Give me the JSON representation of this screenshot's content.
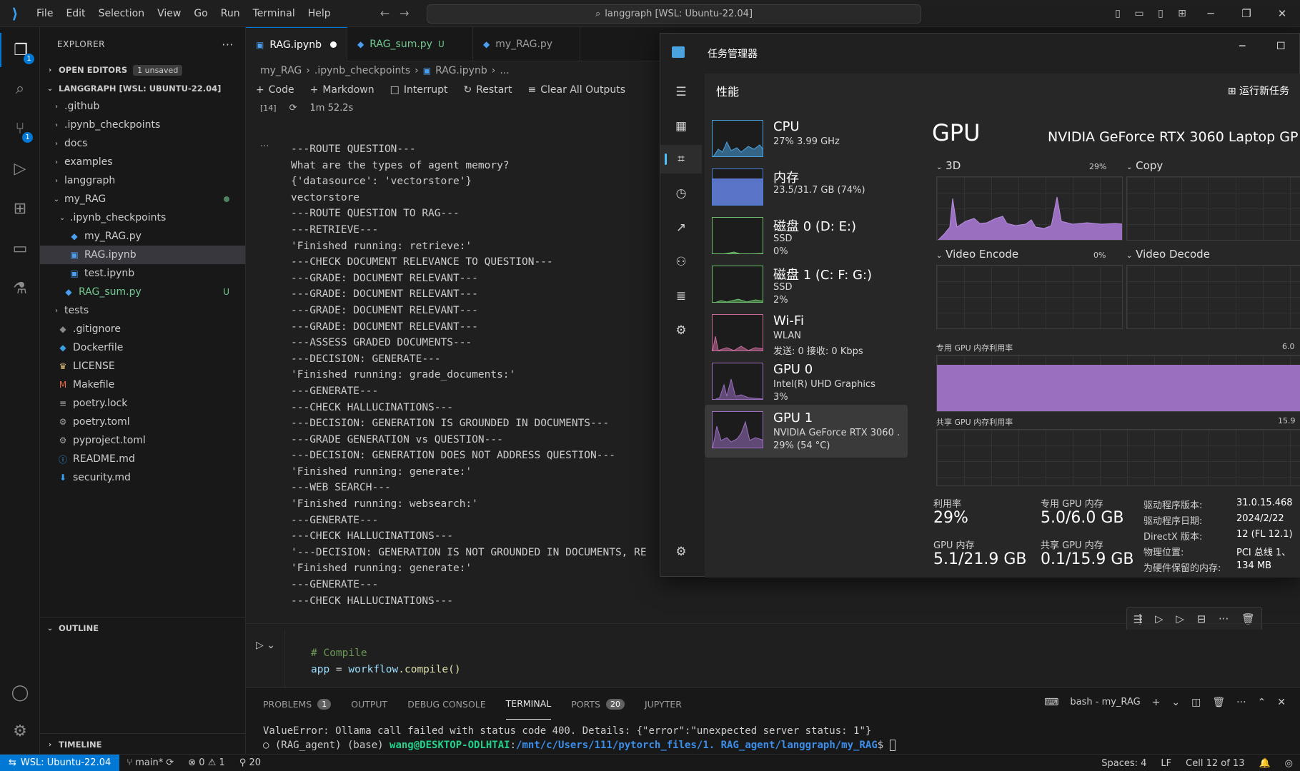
{
  "titlebar": {
    "menus": [
      "File",
      "Edit",
      "Selection",
      "View",
      "Go",
      "Run",
      "Terminal",
      "Help"
    ],
    "command_center": "langgraph [WSL: Ubuntu-22.04]"
  },
  "activity": {
    "explorer_badge": "1",
    "scm_badge": "1"
  },
  "sidebar": {
    "title": "EXPLORER",
    "open_editors": "OPEN EDITORS",
    "unsaved": "1 unsaved",
    "workspace": "LANGGRAPH [WSL: UBUNTU-22.04]",
    "tree": [
      {
        "label": ".github",
        "kind": "folder",
        "indent": 0
      },
      {
        "label": ".ipynb_checkpoints",
        "kind": "folder",
        "indent": 0
      },
      {
        "label": "docs",
        "kind": "folder",
        "indent": 0
      },
      {
        "label": "examples",
        "kind": "folder",
        "indent": 0
      },
      {
        "label": "langgraph",
        "kind": "folder",
        "indent": 0
      },
      {
        "label": "my_RAG",
        "kind": "folder-open",
        "indent": 0,
        "dot": true
      },
      {
        "label": ".ipynb_checkpoints",
        "kind": "folder-open",
        "indent": 1
      },
      {
        "label": "my_RAG.py",
        "kind": "py",
        "indent": 2
      },
      {
        "label": "RAG.ipynb",
        "kind": "nb",
        "indent": 2,
        "selected": true
      },
      {
        "label": "test.ipynb",
        "kind": "nb",
        "indent": 2
      },
      {
        "label": "RAG_sum.py",
        "kind": "py",
        "indent": 1,
        "status": "U"
      },
      {
        "label": "tests",
        "kind": "folder",
        "indent": 0
      },
      {
        "label": ".gitignore",
        "kind": "git",
        "indent": 0
      },
      {
        "label": "Dockerfile",
        "kind": "docker",
        "indent": 0
      },
      {
        "label": "LICENSE",
        "kind": "license",
        "indent": 0
      },
      {
        "label": "Makefile",
        "kind": "make",
        "indent": 0
      },
      {
        "label": "poetry.lock",
        "kind": "lock",
        "indent": 0
      },
      {
        "label": "poetry.toml",
        "kind": "gear",
        "indent": 0
      },
      {
        "label": "pyproject.toml",
        "kind": "gear",
        "indent": 0
      },
      {
        "label": "README.md",
        "kind": "info",
        "indent": 0
      },
      {
        "label": "security.md",
        "kind": "md",
        "indent": 0
      }
    ],
    "outline": "OUTLINE",
    "timeline": "TIMELINE"
  },
  "editor": {
    "tabs": [
      {
        "label": "RAG.ipynb",
        "active": true,
        "dirty": true
      },
      {
        "label": "RAG_sum.py",
        "status": "U"
      },
      {
        "label": "my_RAG.py"
      }
    ],
    "breadcrumb": [
      "my_RAG",
      ".ipynb_checkpoints",
      "RAG.ipynb",
      "..."
    ],
    "toolbar": {
      "code": "Code",
      "markdown": "Markdown",
      "interrupt": "Interrupt",
      "restart": "Restart",
      "clear": "Clear All Outputs"
    },
    "cell_index": "[14]",
    "cell_time": "1m 52.2s",
    "output_lines": [
      "---ROUTE QUESTION---",
      "What are the types of agent memory?",
      "{'datasource': 'vectorstore'}",
      "vectorstore",
      "---ROUTE QUESTION TO RAG---",
      "---RETRIEVE---",
      "'Finished running: retrieve:'",
      "---CHECK DOCUMENT RELEVANCE TO QUESTION---",
      "---GRADE: DOCUMENT RELEVANT---",
      "---GRADE: DOCUMENT RELEVANT---",
      "---GRADE: DOCUMENT RELEVANT---",
      "---GRADE: DOCUMENT RELEVANT---",
      "---ASSESS GRADED DOCUMENTS---",
      "---DECISION: GENERATE---",
      "'Finished running: grade_documents:'",
      "---GENERATE---",
      "---CHECK HALLUCINATIONS---",
      "---DECISION: GENERATION IS GROUNDED IN DOCUMENTS---",
      "---GRADE GENERATION vs QUESTION---",
      "---DECISION: GENERATION DOES NOT ADDRESS QUESTION---",
      "'Finished running: generate:'",
      "---WEB SEARCH---",
      "'Finished running: websearch:'",
      "---GENERATE---",
      "---CHECK HALLUCINATIONS---",
      "'---DECISION: GENERATION IS NOT GROUNDED IN DOCUMENTS, RE",
      "'Finished running: generate:'",
      "---GENERATE---",
      "---CHECK HALLUCINATIONS---"
    ],
    "code_comment": "# Compile",
    "code_var": "app",
    "code_eq": " = ",
    "code_obj": "workflow",
    "code_call": ".compile()"
  },
  "panel": {
    "tabs": [
      "PROBLEMS",
      "OUTPUT",
      "DEBUG CONSOLE",
      "TERMINAL",
      "PORTS",
      "JUPYTER"
    ],
    "problems_count": "1",
    "ports_count": "20",
    "terminal_name": "bash - my_RAG",
    "line1": "ValueError: Ollama call failed with status code 400. Details: {\"error\":\"unexpected server status: 1\"}",
    "line2_prefix": "○ (RAG_agent) (base) ",
    "line2_user": "wang@DESKTOP-ODLHTAI",
    "line2_colon": ":",
    "line2_path": "/mnt/c/Users/111/pytorch_files/1. RAG_agent/langgraph/my_RAG",
    "line2_prompt": "$ "
  },
  "statusbar": {
    "remote": "WSL: Ubuntu-22.04",
    "branch": "main*",
    "errors": "0",
    "warnings": "1",
    "ports": "20",
    "spaces": "Spaces: 4",
    "eol": "LF",
    "cell": "Cell 12 of 13"
  },
  "taskmgr": {
    "title": "任务管理器",
    "section": "性能",
    "new_task": "运行新任务",
    "resources": [
      {
        "name": "CPU",
        "l1": "27% 3.99 GHz",
        "l2": "",
        "l3": ""
      },
      {
        "name": "内存",
        "l1": "23.5/31.7 GB (74%)",
        "l2": "",
        "l3": ""
      },
      {
        "name": "磁盘 0 (D: E:)",
        "l1": "SSD",
        "l2": "0%",
        "l3": ""
      },
      {
        "name": "磁盘 1 (C: F: G:)",
        "l1": "SSD",
        "l2": "2%",
        "l3": ""
      },
      {
        "name": "Wi-Fi",
        "l1": "WLAN",
        "l2": "发送: 0 接收: 0 Kbps",
        "l3": ""
      },
      {
        "name": "GPU 0",
        "l1": "Intel(R) UHD Graphics",
        "l2": "3%",
        "l3": ""
      },
      {
        "name": "GPU 1",
        "l1": "NVIDIA GeForce RTX 3060 .",
        "l2": "29% (54 °C)",
        "l3": ""
      }
    ],
    "gpu_title": "GPU",
    "gpu_model": "NVIDIA GeForce RTX 3060 Laptop GP",
    "engine_3d": "3D",
    "engine_3d_pct": "29%",
    "engine_copy": "Copy",
    "engine_encode": "Video Encode",
    "engine_encode_pct": "0%",
    "engine_decode": "Video Decode",
    "dedicated_label": "专用 GPU 内存利用率",
    "dedicated_max": "6.0",
    "shared_label": "共享 GPU 内存利用率",
    "shared_max": "15.9",
    "util_label": "利用率",
    "util_value": "29%",
    "dedmem_label": "专用 GPU 内存",
    "dedmem_value": "5.0/6.0 GB",
    "gpumem_label": "GPU 内存",
    "gpumem_value": "5.1/21.9 GB",
    "shmem_label": "共享 GPU 内存",
    "shmem_value": "0.1/15.9 GB",
    "info": [
      {
        "k": "驱动程序版本:",
        "v": "31.0.15.468"
      },
      {
        "k": "驱动程序日期:",
        "v": "2024/2/22"
      },
      {
        "k": "DirectX 版本:",
        "v": "12 (FL 12.1)"
      },
      {
        "k": "物理位置:",
        "v": "PCI 总线 1、"
      },
      {
        "k": "为硬件保留的内存:",
        "v": "134 MB"
      }
    ],
    "dedicated_fill": 0.83
  }
}
